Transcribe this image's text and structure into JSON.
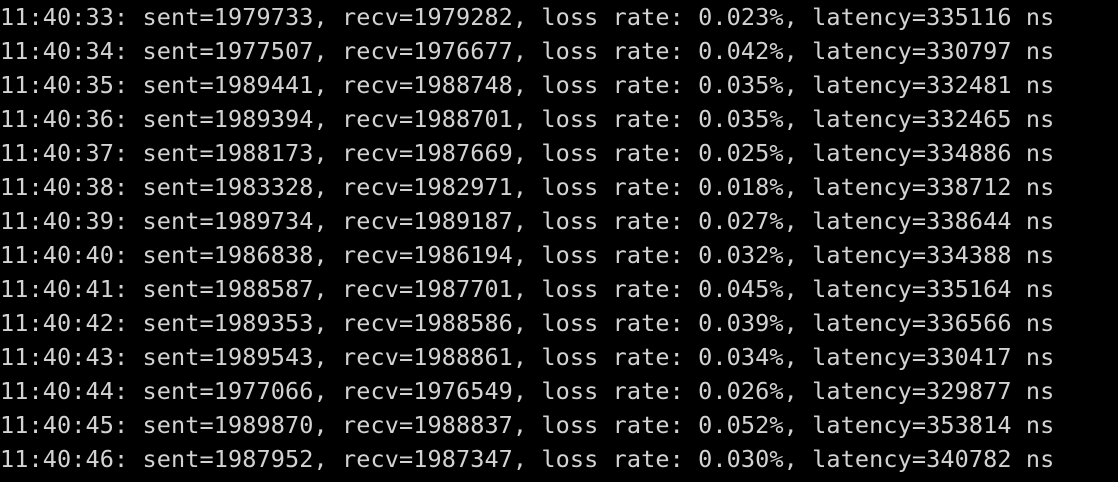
{
  "terminal": {
    "lines": [
      "11:40:33: sent=1979733, recv=1979282, loss rate: 0.023%, latency=335116 ns",
      "11:40:34: sent=1977507, recv=1976677, loss rate: 0.042%, latency=330797 ns",
      "11:40:35: sent=1989441, recv=1988748, loss rate: 0.035%, latency=332481 ns",
      "11:40:36: sent=1989394, recv=1988701, loss rate: 0.035%, latency=332465 ns",
      "11:40:37: sent=1988173, recv=1987669, loss rate: 0.025%, latency=334886 ns",
      "11:40:38: sent=1983328, recv=1982971, loss rate: 0.018%, latency=338712 ns",
      "11:40:39: sent=1989734, recv=1989187, loss rate: 0.027%, latency=338644 ns",
      "11:40:40: sent=1986838, recv=1986194, loss rate: 0.032%, latency=334388 ns",
      "11:40:41: sent=1988587, recv=1987701, loss rate: 0.045%, latency=335164 ns",
      "11:40:42: sent=1989353, recv=1988586, loss rate: 0.039%, latency=336566 ns",
      "11:40:43: sent=1989543, recv=1988861, loss rate: 0.034%, latency=330417 ns",
      "11:40:44: sent=1977066, recv=1976549, loss rate: 0.026%, latency=329877 ns",
      "11:40:45: sent=1989870, recv=1988837, loss rate: 0.052%, latency=353814 ns",
      "11:40:46: sent=1987952, recv=1987347, loss rate: 0.030%, latency=340782 ns"
    ],
    "colors": {
      "background": "#000000",
      "text": "#d3d3d3"
    }
  }
}
